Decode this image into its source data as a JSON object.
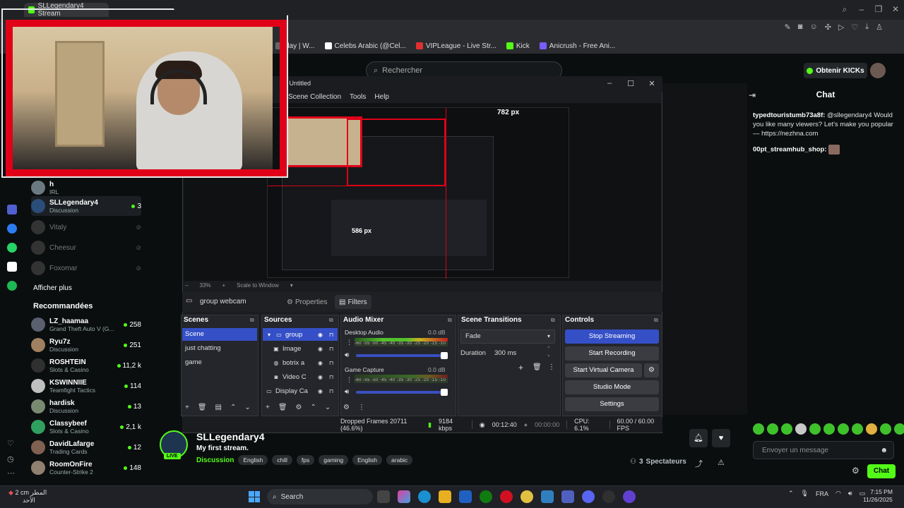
{
  "browser": {
    "tab_title": "SLLegendary4 Stream",
    "bookmarks": [
      {
        "label": "day | W...",
        "color": "#666666"
      },
      {
        "label": "Celebs Arabic (@Cel...",
        "color": "#ffffff"
      },
      {
        "label": "VIPLeague - Live Str...",
        "color": "#e03030"
      },
      {
        "label": "Kick",
        "color": "#53fc18"
      },
      {
        "label": "Anicrush - Free Ani...",
        "color": "#7b5cff"
      }
    ]
  },
  "kick": {
    "search_placeholder": "Rechercher",
    "get_kicks": "Obtenir KICKs",
    "sidebar": {
      "channels_top": [
        {
          "name": "h",
          "sub": "IRL",
          "count": "",
          "color": "#6a7a80",
          "live": true
        },
        {
          "name": "SLLegendary4",
          "sub": "Discussion",
          "count": "3",
          "color": "#2a4d7a",
          "live": true
        },
        {
          "name": "Vitaly",
          "sub": "",
          "count": "",
          "color": "#333",
          "live": false
        },
        {
          "name": "Cheesur",
          "sub": "",
          "count": "",
          "color": "#333",
          "live": false
        },
        {
          "name": "Foxomar",
          "sub": "",
          "count": "",
          "color": "#333",
          "live": false
        }
      ],
      "show_more": "Afficher plus",
      "recommended_title": "Recommandées",
      "recommended": [
        {
          "name": "LZ_haamaa",
          "sub": "Grand Theft Auto V (G...",
          "count": "258",
          "color": "#5a6070"
        },
        {
          "name": "Ryu7z",
          "sub": "Discussion",
          "count": "251",
          "color": "#a08060"
        },
        {
          "name": "ROSHTEIN",
          "sub": "Slots & Casino",
          "count": "11,2 k",
          "color": "#303030"
        },
        {
          "name": "KSWINNIIE",
          "sub": "Teamfight Tactics",
          "count": "114",
          "color": "#c0c0c0"
        },
        {
          "name": "hardisk",
          "sub": "Discussion",
          "count": "13",
          "color": "#7a8a70"
        },
        {
          "name": "Classybeef",
          "sub": "Slots & Casino",
          "count": "2,1 k",
          "color": "#30a060"
        },
        {
          "name": "DavidLafarge",
          "sub": "Trading Cards",
          "count": "12",
          "color": "#806050"
        },
        {
          "name": "RoomOnFire",
          "sub": "Counter-Strike 2",
          "count": "148",
          "color": "#908070"
        }
      ]
    },
    "chat": {
      "title": "Chat",
      "messages": [
        {
          "user": "typedtouristumb73a8f:",
          "text": "@sllegendary4 Would you like many viewers? Let's make you popular — https://nezhna.com"
        },
        {
          "user": "00pt_streamhub_shop:",
          "text": ""
        }
      ],
      "input_placeholder": "Envoyer un message",
      "send_label": "Chat"
    },
    "stream": {
      "streamer": "SLLegendary4",
      "title": "My first stream.",
      "live_label": "LIVE",
      "category": "Discussion",
      "tags": [
        "English",
        "chill",
        "fps",
        "gaming",
        "English",
        "arabic"
      ],
      "viewers": "3",
      "viewers_label": "Spectateurs"
    }
  },
  "obs": {
    "title": "s: Untitled",
    "menu": [
      "Scene Collection",
      "Tools",
      "Help"
    ],
    "preview": {
      "width_label": "782 px",
      "height_label": "586 px",
      "zoom": "33%",
      "scale_mode": "Scale to Window"
    },
    "source_bar": {
      "name": "group webcam",
      "properties": "Properties",
      "filters": "Filters"
    },
    "scenes": {
      "title": "Scenes",
      "items": [
        "Scene",
        "just chatting",
        "game"
      ]
    },
    "sources": {
      "title": "Sources",
      "items": [
        "group",
        "Image",
        "botrix a",
        "Video C",
        "Display Ca"
      ]
    },
    "mixer": {
      "title": "Audio Mixer",
      "channels": [
        {
          "name": "Desktop Audio",
          "db": "0.0 dB"
        },
        {
          "name": "Game Capture",
          "db": "0.0 dB"
        }
      ],
      "scale": "-60 -55 -50 -45 -40 -35 -30 -25 -20 -15 -10 -5 0"
    },
    "transitions": {
      "title": "Scene Transitions",
      "type": "Fade",
      "duration_label": "Duration",
      "duration": "300 ms"
    },
    "controls": {
      "title": "Controls",
      "buttons": [
        "Stop Streaming",
        "Start Recording",
        "Start Virtual Camera",
        "Studio Mode",
        "Settings"
      ]
    },
    "status": {
      "dropped": "Dropped Frames 20711 (46.6%)",
      "bitrate": "9184 kbps",
      "live_time": "00:12:40",
      "rec_time": "00:00:00",
      "cpu": "CPU: 6.1%",
      "fps": "60.00 / 60.00 FPS"
    }
  },
  "taskbar": {
    "weather_temp": "2 cm",
    "weather_desc": "المطر",
    "weather_day": "الأحد",
    "search": "Search",
    "lang": "FRA",
    "time": "7:15 PM",
    "date": "11/26/2025"
  }
}
